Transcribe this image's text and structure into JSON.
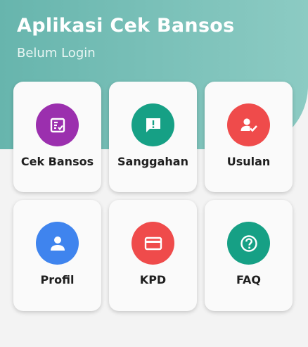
{
  "header": {
    "title": "Aplikasi Cek Bansos",
    "subtitle": "Belum Login"
  },
  "menu": [
    {
      "label": "Cek Bansos",
      "icon": "checklist-doc-icon",
      "color": "#9b2fae"
    },
    {
      "label": "Sanggahan",
      "icon": "chat-alert-icon",
      "color": "#16a085"
    },
    {
      "label": "Usulan",
      "icon": "user-check-icon",
      "color": "#ef4b4b"
    },
    {
      "label": "Profil",
      "icon": "person-icon",
      "color": "#3f84ee"
    },
    {
      "label": "KPD",
      "icon": "card-icon",
      "color": "#ef4b4b"
    },
    {
      "label": "FAQ",
      "icon": "question-icon",
      "color": "#16a085"
    }
  ]
}
